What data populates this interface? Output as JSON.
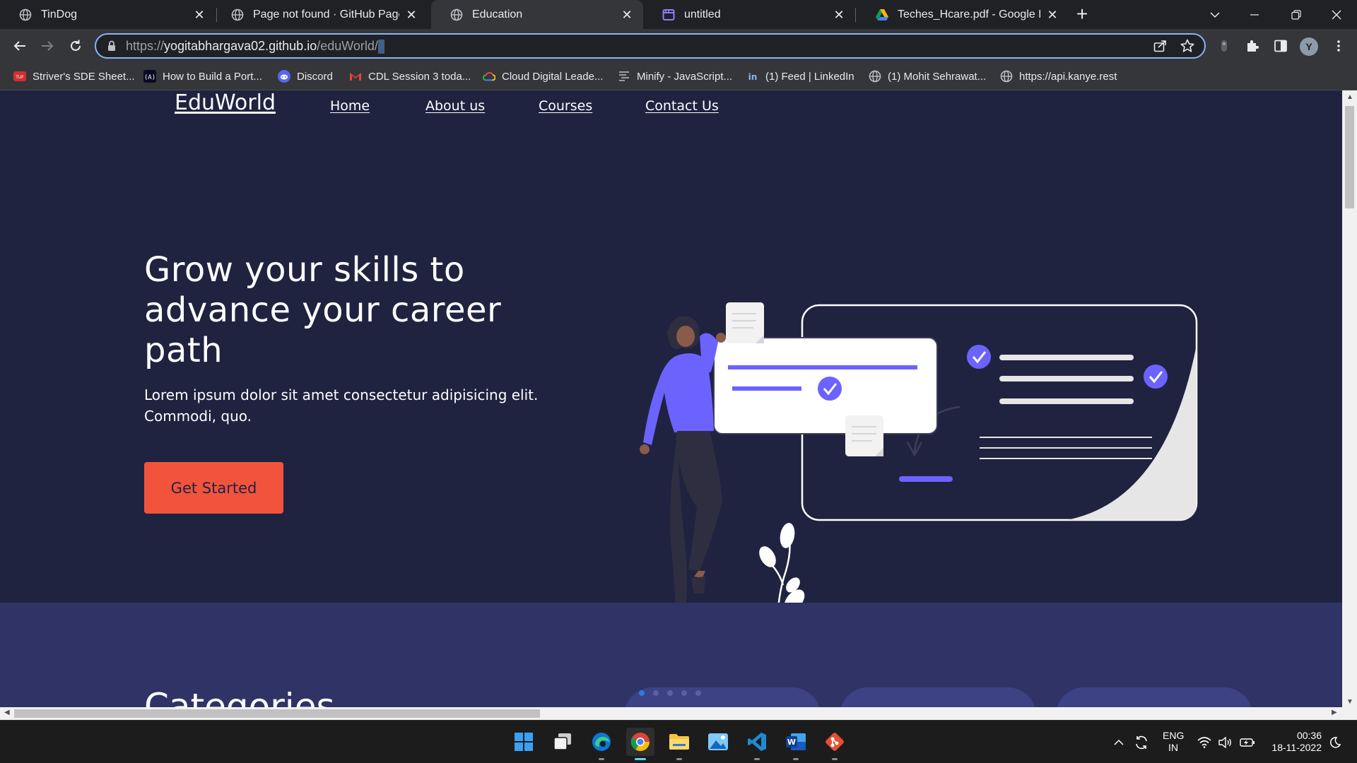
{
  "browser": {
    "tabs": [
      {
        "title": "TinDog",
        "active": false
      },
      {
        "title": "Page not found · GitHub Pages",
        "active": false
      },
      {
        "title": "Education",
        "active": true
      },
      {
        "title": "untitled",
        "active": false
      },
      {
        "title": "Teches_Hcare.pdf - Google Drive",
        "active": false
      }
    ],
    "url": {
      "scheme": "https://",
      "host": "yogitabhargava02.github.io",
      "path": "/eduWorld/"
    },
    "profile_initial": "Y",
    "bookmarks": [
      {
        "label": "Striver's SDE Sheet...",
        "icon": "tuf-icon"
      },
      {
        "label": "How to Build a Port...",
        "icon": "code-icon"
      },
      {
        "label": "Discord",
        "icon": "discord-icon"
      },
      {
        "label": "CDL Session 3 toda...",
        "icon": "gmail-icon"
      },
      {
        "label": "Cloud Digital Leade...",
        "icon": "google-cloud-icon"
      },
      {
        "label": "Minify - JavaScript...",
        "icon": "minify-icon"
      },
      {
        "label": "(1) Feed | LinkedIn",
        "icon": "linkedin-icon"
      },
      {
        "label": "(1) Mohit Sehrawat...",
        "icon": "globe-icon"
      },
      {
        "label": "https://api.kanye.rest",
        "icon": "globe-icon"
      }
    ]
  },
  "site": {
    "brand": "EduWorld",
    "nav": [
      "Home",
      "About us",
      "Courses",
      "Contact Us"
    ],
    "hero": {
      "title": "Grow your skills to advance your career path",
      "subtitle": "Lorem ipsum dolor sit amet consectetur adipisicing elit. Commodi, quo.",
      "cta": "Get Started"
    },
    "section2_title": "Categories",
    "colors": {
      "hero_bg": "#1f2340",
      "section_bg": "#2f3366",
      "cta": "#f2533d",
      "accent": "#6c63ff"
    }
  },
  "taskbar": {
    "apps": [
      "windows-start-icon",
      "task-view-icon",
      "edge-icon",
      "chrome-icon",
      "file-explorer-icon",
      "photos-icon",
      "vscode-icon",
      "word-icon",
      "git-icon"
    ],
    "lang_line1": "ENG",
    "lang_line2": "IN",
    "time": "00:36",
    "date": "18-11-2022"
  }
}
